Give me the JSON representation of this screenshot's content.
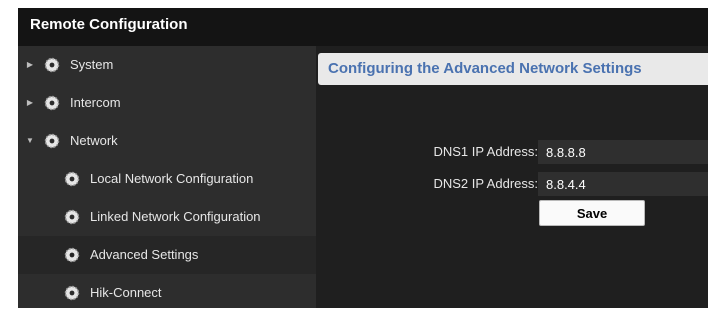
{
  "window": {
    "title": "Remote Configuration"
  },
  "sidebar": {
    "items": [
      {
        "label": "System",
        "icon": "gear-icon",
        "expander": "chevron-right"
      },
      {
        "label": "Intercom",
        "icon": "gear-icon",
        "expander": "chevron-right"
      },
      {
        "label": "Network",
        "icon": "gear-icon",
        "expander": "chevron-down",
        "expanded": true
      },
      {
        "label": "Local Network Configuration",
        "icon": "gear-icon"
      },
      {
        "label": "Linked Network Configuration",
        "icon": "gear-icon"
      },
      {
        "label": "Advanced Settings",
        "icon": "gear-icon",
        "selected": true
      },
      {
        "label": "Hik-Connect",
        "icon": "gear-icon"
      }
    ]
  },
  "main": {
    "section_title": "Configuring the Advanced Network Settings",
    "fields": {
      "dns1": {
        "label": "DNS1 IP Address:",
        "value": "8.8.8.8"
      },
      "dns2": {
        "label": "DNS2 IP Address:",
        "value": "8.8.4.4"
      }
    },
    "save_label": "Save"
  },
  "colors": {
    "title_bar": "#141414",
    "sidebar": "#2d2d2d",
    "content": "#1f1f1f",
    "header_text": "#4a72b0",
    "input": "#2f2f2f"
  }
}
